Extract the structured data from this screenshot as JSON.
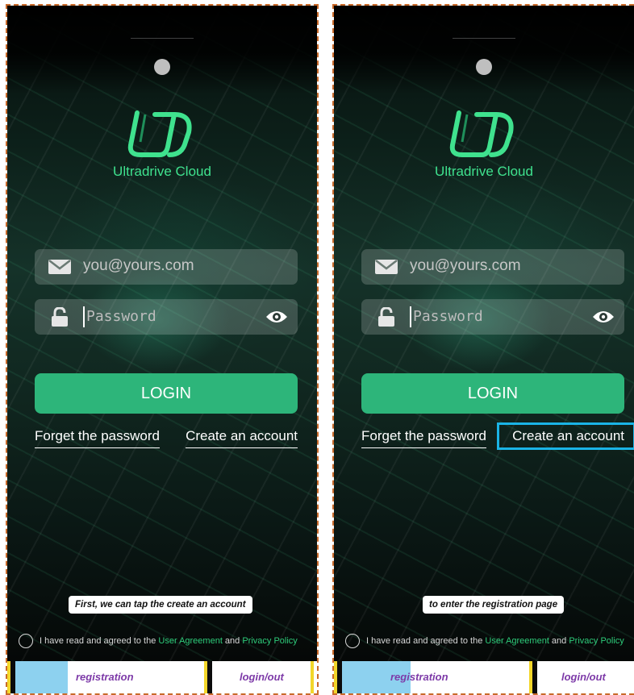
{
  "panels": [
    {
      "app_name": "Ultradrive Cloud",
      "email_placeholder": "you@yours.com",
      "password_placeholder": "Password",
      "login_label": "LOGIN",
      "forget_label": "Forget the password",
      "create_label": "Create an account",
      "caption": "First, we can tap the create an account",
      "agree_prefix": "I have read and agreed to the ",
      "agree_user": "User Agreement",
      "agree_and": " and ",
      "agree_privacy": "Privacy Policy",
      "tab_registration": "registration",
      "tab_login": "login/out"
    },
    {
      "app_name": "Ultradrive Cloud",
      "email_placeholder": "you@yours.com",
      "password_placeholder": "Password",
      "login_label": "LOGIN",
      "forget_label": "Forget the password",
      "create_label": "Create an account",
      "caption": "to enter the registration page",
      "agree_prefix": "I have read and agreed to the ",
      "agree_user": "User Agreement",
      "agree_and": " and ",
      "agree_privacy": "Privacy Policy",
      "tab_registration": "registration",
      "tab_login": "login/out"
    }
  ],
  "highlight_target": "Create an account",
  "colors": {
    "brand_green": "#3fe28e",
    "button_green": "#2db57a",
    "highlight_blue": "#1ab4e6",
    "panel_border": "#c96a2a"
  },
  "icons": [
    "camera-dot",
    "ud-logo",
    "mail-icon",
    "lock-icon",
    "eye-icon",
    "radio-unchecked-icon"
  ]
}
